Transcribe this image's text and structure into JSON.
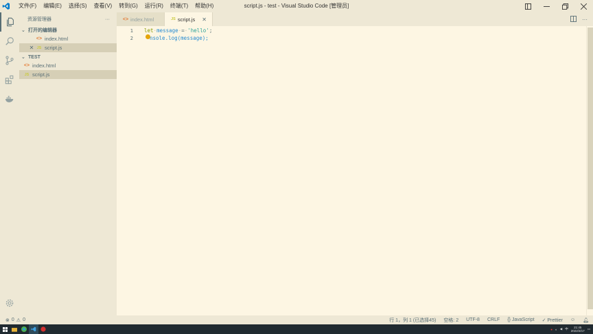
{
  "titlebar": {
    "menu": [
      "文件(F)",
      "编辑(E)",
      "选择(S)",
      "查看(V)",
      "转到(G)",
      "运行(R)",
      "终端(T)",
      "帮助(H)"
    ],
    "title": "script.js - test - Visual Studio Code [管理员]"
  },
  "sidebar": {
    "header": "资源管理器",
    "more": "···",
    "open_editors": {
      "label": "打开的编辑器",
      "items": [
        {
          "name": "index.html",
          "icon": "html-file-icon"
        },
        {
          "name": "script.js",
          "icon": "js-file-icon"
        }
      ]
    },
    "folder": {
      "label": "TEST",
      "items": [
        {
          "name": "index.html",
          "icon": "html-file-icon"
        },
        {
          "name": "script.js",
          "icon": "js-file-icon"
        }
      ]
    }
  },
  "tabs": [
    {
      "label": "index.html",
      "icon": "html-file-icon",
      "active": false
    },
    {
      "label": "script.js",
      "icon": "js-file-icon",
      "active": true
    }
  ],
  "file_icon_labels": {
    "html": "<>",
    "js": "JS"
  },
  "editor": {
    "line_numbers": [
      "1",
      "2"
    ],
    "line1": {
      "kw": "let",
      "name": "message",
      "eq": "=",
      "str": "'hello'",
      "end": ";"
    },
    "line2": {
      "text": "nsole.log(message);"
    }
  },
  "statusbar": {
    "errors": "0",
    "warnings": "0",
    "position": "行 1，列 1 (已选择45)",
    "spaces": "空格: 2",
    "encoding": "UTF-8",
    "eol": "CRLF",
    "language": "JavaScript",
    "formatter": "Prettier"
  },
  "taskbar": {
    "time": "21:45",
    "date": "2022/3/17"
  },
  "colors": {
    "background": "#fdf6e3",
    "chrome": "#eee8d5",
    "accent": "#007acc"
  }
}
